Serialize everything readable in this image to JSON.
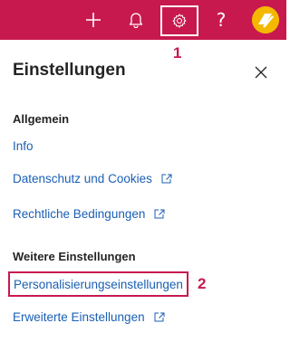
{
  "topbar": {
    "icons": [
      "add-icon",
      "bell-icon",
      "gear-icon",
      "help-icon",
      "avatar"
    ],
    "help_glyph": "?",
    "bg_color": "#c8194f"
  },
  "callouts": {
    "first": "1",
    "second": "2",
    "color": "#c8194f"
  },
  "panel": {
    "title": "Einstellungen",
    "sections": [
      {
        "heading": "Allgemein",
        "items": [
          {
            "label": "Info",
            "external": false
          },
          {
            "label": "Datenschutz und Cookies",
            "external": true
          },
          {
            "label": "Rechtliche Bedingungen",
            "external": true
          }
        ]
      },
      {
        "heading": "Weitere Einstellungen",
        "items": [
          {
            "label": "Personalisierungseinstellungen",
            "external": false,
            "highlighted": true
          },
          {
            "label": "Erweiterte Einstellungen",
            "external": true
          }
        ]
      }
    ]
  },
  "colors": {
    "link": "#1a5fb4",
    "text": "#252423",
    "accent": "#c8194f"
  }
}
